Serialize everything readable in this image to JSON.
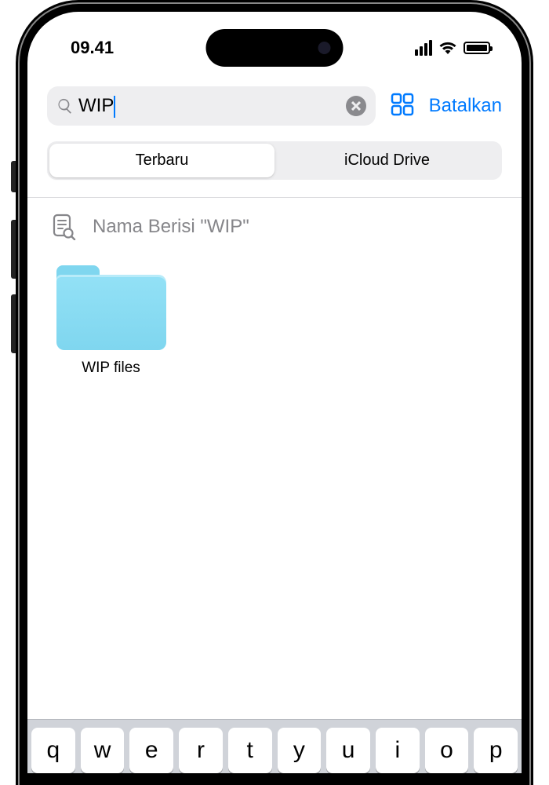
{
  "status": {
    "time": "09.41"
  },
  "search": {
    "value": "WIP",
    "cancel_label": "Batalkan"
  },
  "segments": {
    "recent": "Terbaru",
    "icloud": "iCloud Drive"
  },
  "hint": {
    "text": "Nama Berisi \"WIP\""
  },
  "results": [
    {
      "label": "WIP files"
    }
  ],
  "keyboard": {
    "row1": [
      "q",
      "w",
      "e",
      "r",
      "t",
      "y",
      "u",
      "i",
      "o",
      "p"
    ]
  },
  "colors": {
    "accent": "#007aff",
    "folder": "#7fd6ef"
  }
}
